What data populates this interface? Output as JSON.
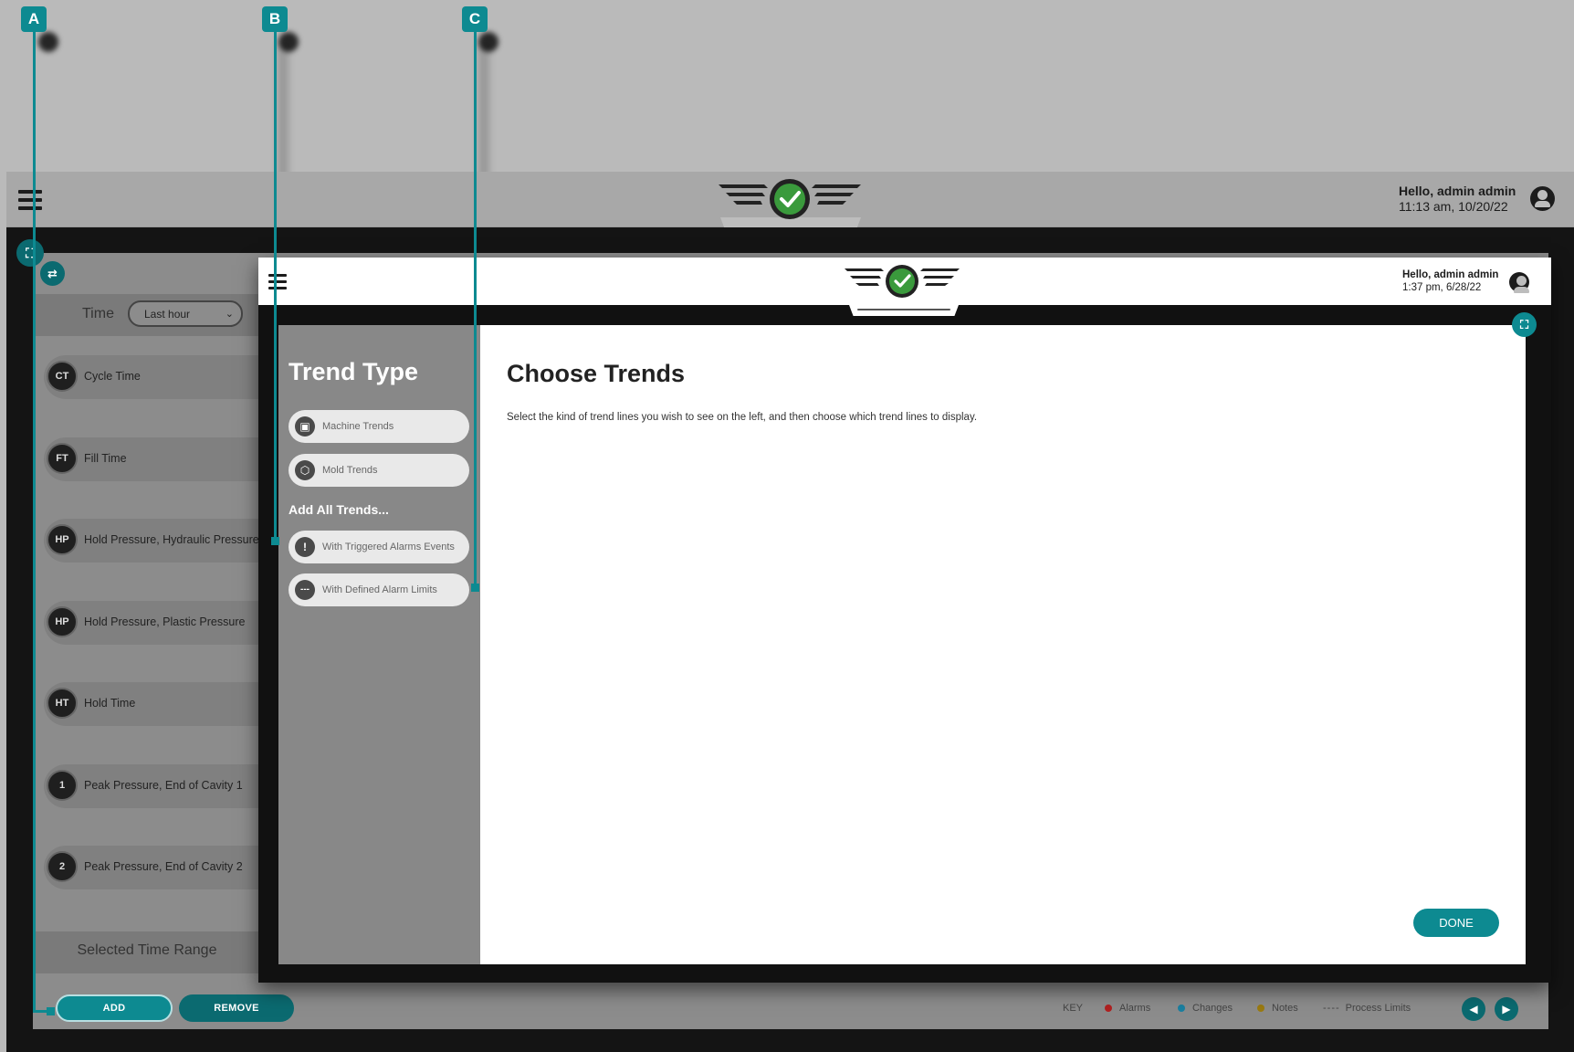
{
  "app": {
    "greeting": "Hello, admin admin",
    "timestamp": "11:13 am, 10/20/22"
  },
  "filters": {
    "time_label": "Time",
    "time_value": "Last hour"
  },
  "trend_items": [
    {
      "badge": "CT",
      "label": "Cycle Time"
    },
    {
      "badge": "FT",
      "label": "Fill Time"
    },
    {
      "badge": "HP",
      "label": "Hold Pressure, Hydraulic Pressure"
    },
    {
      "badge": "HP",
      "label": "Hold Pressure, Plastic Pressure"
    },
    {
      "badge": "HT",
      "label": "Hold Time"
    },
    {
      "badge": "1",
      "label": "Peak Pressure, End of Cavity 1"
    },
    {
      "badge": "2",
      "label": "Peak Pressure, End of Cavity 2"
    }
  ],
  "selected_time_range": "Selected Time Range",
  "actions": {
    "add": "ADD",
    "remove": "REMOVE"
  },
  "legend": {
    "key": "KEY",
    "alarms": "Alarms",
    "changes": "Changes",
    "notes": "Notes",
    "process_limits": "Process Limits",
    "colors": {
      "alarms": "#b02020",
      "changes": "#1a7fa0",
      "notes": "#9a7a10"
    }
  },
  "inset": {
    "greeting": "Hello, admin admin",
    "timestamp": "1:37 pm, 6/28/22",
    "trend_type_title": "Trend Type",
    "trend_types": [
      {
        "label": "Machine Trends",
        "icon": "machine-icon"
      },
      {
        "label": "Mold Trends",
        "icon": "mold-icon"
      }
    ],
    "add_all_label": "Add All Trends...",
    "add_all_options": [
      {
        "label": "With Triggered Alarms Events",
        "icon": "alarm-exclamation-icon"
      },
      {
        "label": "With Defined Alarm Limits",
        "icon": "dashed-limits-icon"
      }
    ],
    "choose_title": "Choose Trends",
    "choose_text": "Select the kind of trend lines you wish to see on the left, and then choose which trend lines to display.",
    "done_label": "DONE"
  },
  "callouts": [
    "A",
    "B",
    "C"
  ],
  "colors": {
    "accent": "#0d8a91",
    "logo_green": "#3a9a3c"
  }
}
